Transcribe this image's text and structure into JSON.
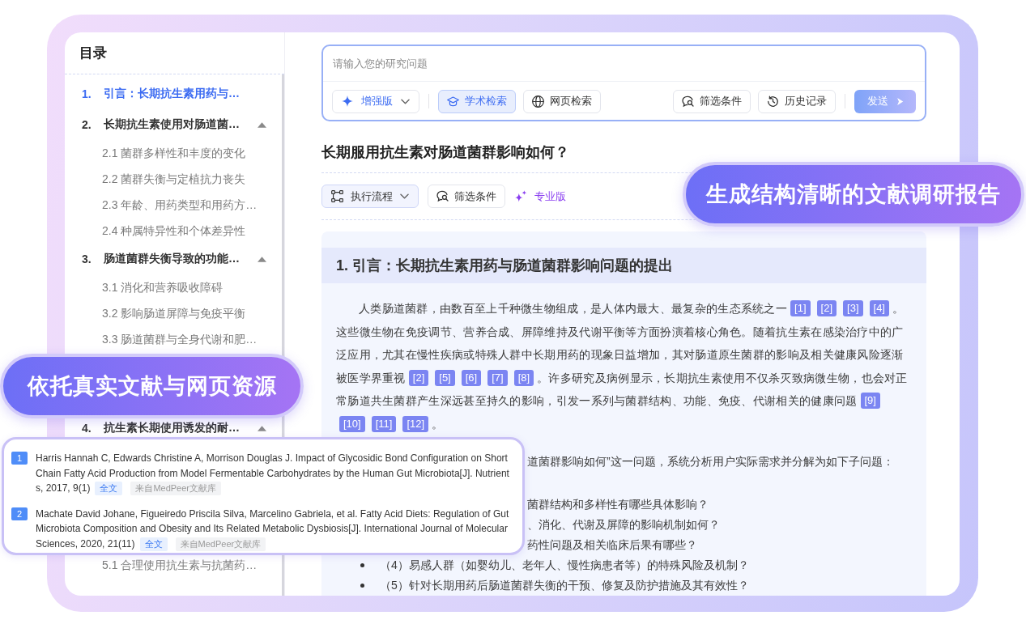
{
  "sidebar": {
    "title": "目录",
    "items": [
      {
        "number": "1.",
        "label": "引言：长期抗生素用药与…",
        "selected": true
      },
      {
        "number": "2.",
        "label": "长期抗生素使用对肠道菌…",
        "selected": false,
        "expanded": true,
        "children": [
          {
            "label": "2.1 菌群多样性和丰度的变化",
            "selected": false
          },
          {
            "label": "2.2 菌群失衡与定植抗力丧失",
            "selected": false
          },
          {
            "label": "2.3 年龄、用药类型和用药方…",
            "selected": false
          },
          {
            "label": "2.4 种属特异性和个体差异性",
            "selected": false
          }
        ]
      },
      {
        "number": "3.",
        "label": "肠道菌群失衡导致的功能…",
        "selected": false,
        "expanded": true,
        "children": [
          {
            "label": "3.1 消化和营养吸收障碍",
            "selected": false
          },
          {
            "label": "3.2 影响肠道屏障与免疫平衡",
            "selected": false
          },
          {
            "label": "3.3 肠道菌群与全身代谢和肥…",
            "selected": false
          }
        ]
      },
      {
        "number": "4.",
        "label": "抗生素长期使用诱发的耐…",
        "selected": false,
        "expanded": true
      },
      {
        "children": [
          {
            "label": "5.1 合理使用抗生素与抗菌药…",
            "selected": false
          }
        ]
      }
    ]
  },
  "search": {
    "placeholder": "请输入您的研究问题",
    "mode": {
      "label": "增强版"
    },
    "sources": [
      {
        "kind": "academic",
        "label": "学术检索",
        "selected": true
      },
      {
        "kind": "web",
        "label": "网页检索",
        "selected": false
      }
    ],
    "actions": [
      {
        "kind": "filter",
        "label": "筛选条件"
      },
      {
        "kind": "history",
        "label": "历史记录"
      }
    ],
    "send": {
      "label": "发送",
      "disabled": true
    }
  },
  "question": {
    "title": "长期服用抗生素对肠道菌群影响如何？",
    "tools": [
      {
        "kind": "flow",
        "label": "执行流程"
      },
      {
        "kind": "filter",
        "label": "筛选条件"
      },
      {
        "kind": "edition",
        "label": "专业版"
      }
    ]
  },
  "callouts": [
    {
      "text": "生成结构清晰的文献调研报告"
    },
    {
      "text": "依托真实文献与网页资源"
    }
  ],
  "report": {
    "section_title": "1. 引言：长期抗生素用药与肠道菌群影响问题的提出",
    "paragraph": [
      {
        "kind": "text",
        "text": "人类肠道菌群，由数百至上千种微生物组成，是人体内最大、最复杂的生态系统之一"
      },
      {
        "kind": "citation",
        "text": "[1]"
      },
      {
        "kind": "citation",
        "text": "[2]"
      },
      {
        "kind": "citation",
        "text": "[3]"
      },
      {
        "kind": "citation",
        "text": "[4]"
      },
      {
        "kind": "text",
        "text": "。这些微生物在免疫调节、营养合成、屏障维持及代谢平衡等方面扮演着核心角色。随着抗生素在感染治疗中的广泛应用，尤其在慢性疾病或特殊人群中长期用药的现象日益增加，其对肠道原生菌群的影响及相关健康风险逐渐被医学界重视"
      },
      {
        "kind": "citation",
        "text": "[2]"
      },
      {
        "kind": "citation",
        "text": "[5]"
      },
      {
        "kind": "citation",
        "text": "[6]"
      },
      {
        "kind": "citation",
        "text": "[7]"
      },
      {
        "kind": "citation",
        "text": "[8]"
      },
      {
        "kind": "text",
        "text": "。许多研究及病例显示，长期抗生素使用不仅杀灭致病微生物，也会对正常肠道共生菌群产生深远甚至持久的影响，引发一系列与菌群结构、功能、免疫、代谢相关的健康问题"
      },
      {
        "kind": "citation",
        "text": "[9]"
      },
      {
        "kind": "citation",
        "text": "[10]"
      },
      {
        "kind": "citation",
        "text": "[11]"
      },
      {
        "kind": "citation",
        "text": "[12]"
      },
      {
        "kind": "text",
        "text": "。"
      }
    ],
    "intro": "道菌群影响如何”这一问题，系统分析用户实际需求并分解为如下子问题：",
    "sub_questions": [
      {
        "kind": "clipped",
        "text": "菌群结构和多样性有哪些具体影响？"
      },
      {
        "kind": "clipped",
        "text": "、消化、代谢及屏障的影响机制如何？"
      },
      {
        "kind": "clipped",
        "text": "药性问题及相关临床后果有哪些？"
      },
      {
        "kind": "bulleted",
        "text": "（4）易感人群（如婴幼儿、老年人、慢性病患者等）的特殊风险及机制？"
      },
      {
        "kind": "bulleted",
        "text": "（5）针对长期用药后肠道菌群失衡的干预、修复及防护措施及其有效性？"
      }
    ]
  },
  "references": [
    {
      "number": "1",
      "text": "Harris Hannah C, Edwards Christine A, Morrison Douglas J. Impact of Glycosidic Bond Configuration on Short Chain Fatty Acid Production from Model Fermentable Carbohydrates by the Human Gut Microbiota[J]. Nutrients, 2017, 9(1)",
      "full_text": "全文",
      "source": "来自MedPeer文献库"
    },
    {
      "number": "2",
      "text": "Machate David Johane, Figueiredo Priscila Silva, Marcelino Gabriela, et al. Fatty Acid Diets: Regulation of Gut Microbiota Composition and Obesity and Its Related Metabolic Dysbiosis[J]. International Journal of Molecular Sciences, 2020, 21(11)",
      "full_text": "全文",
      "source": "来自MedPeer文献库"
    }
  ]
}
